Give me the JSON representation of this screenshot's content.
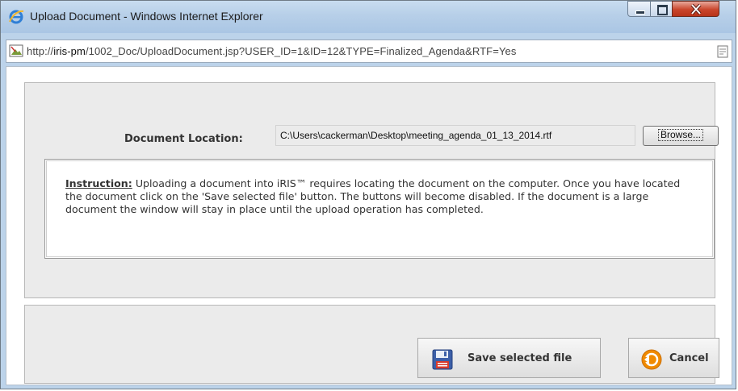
{
  "window": {
    "title": "Upload Document - Windows Internet Explorer",
    "url_prefix": "http://",
    "url_host": "iris-pm",
    "url_path": "/1002_Doc/UploadDocument.jsp?USER_ID=1&ID=12&TYPE=Finalized_Agenda&RTF=Yes"
  },
  "form": {
    "location_label": "Document Location:",
    "file_path": "C:\\Users\\cackerman\\Desktop\\meeting_agenda_01_13_2014.rtf",
    "browse_label": "Browse..."
  },
  "instruction": {
    "heading": "Instruction:",
    "body": "Uploading a document into iRIS™ requires locating the document on the computer. Once you have located the document click on the 'Save selected file' button. The buttons will become disabled. If the document is a large document the window will stay in place until the upload operation has completed."
  },
  "actions": {
    "save_label": "Save selected file",
    "cancel_label": "Cancel"
  },
  "colors": {
    "titlebar": "#b7cfe8",
    "close_button": "#c9452b",
    "panel_bg": "#ebebeb",
    "cancel_icon": "#f08a00",
    "save_icon": "#3c5fa8"
  }
}
